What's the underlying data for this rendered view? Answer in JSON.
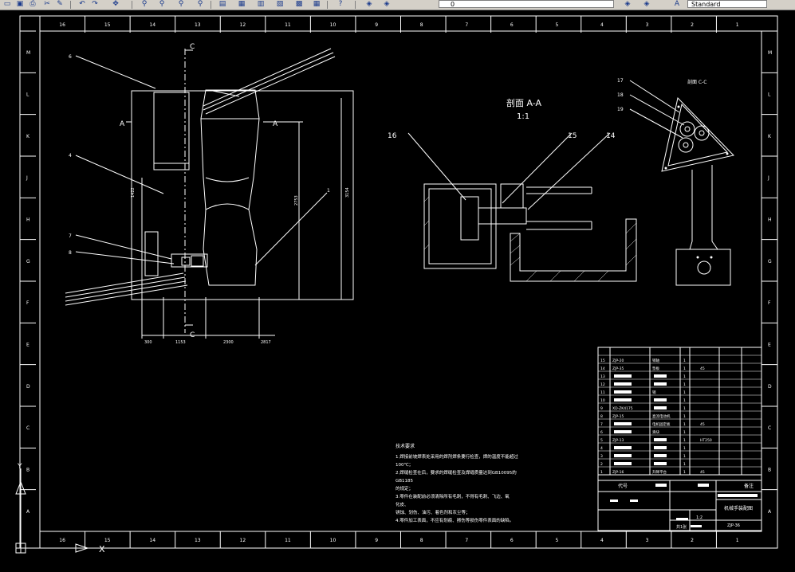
{
  "toolbar": {
    "style_value": "Standard",
    "layer_value": "0"
  },
  "border_columns": [
    "16",
    "15",
    "14",
    "13",
    "12",
    "11",
    "10",
    "9",
    "8",
    "7",
    "6",
    "5",
    "4",
    "3",
    "2",
    "1"
  ],
  "border_rows": [
    "M",
    "L",
    "K",
    "J",
    "H",
    "G",
    "F",
    "E",
    "D",
    "C",
    "B",
    "A"
  ],
  "drawing": {
    "section_aa_title": "剖面 A-A",
    "section_aa_scale": "1:1",
    "section_cc_title": "剖面 C-C",
    "section_marks": [
      "C",
      "C",
      "A",
      "A"
    ],
    "part_callouts_left": [
      "6",
      "4",
      "7",
      "8",
      "1"
    ],
    "part_callouts_mid": [
      "16",
      "15",
      "14"
    ],
    "part_callouts_right": [
      "17",
      "18",
      "19"
    ],
    "dimensions": [
      "300",
      "1153",
      "2300",
      "2817",
      "1422",
      "2753",
      "3154"
    ]
  },
  "notes": {
    "heading": "技术要求",
    "lines": [
      "1.焊接前坡焊表处采用的焊剂焊条要行检查，焊的温度不能超过",
      "100℃；",
      "2.焊缝检查在后，要求的焊缝检查及焊缝质量达到GB10095的",
      "GB1185",
      "的规定；",
      "3.零件在装配前必须清除所有毛刺，不得有毛刺、飞边、氧",
      "化皮、",
      "锈蚀、划伤、油污、着色剂和灰尘等；",
      "4.零件加工表面，不应有划痕、擦伤等损伤零件表面的缺陷。"
    ]
  },
  "title_block": {
    "bom_part_numbers": [
      "ZJP-20",
      "ZJP-35",
      "",
      "",
      "",
      "",
      "XD-ZK4175",
      "ZJP-15",
      "",
      "",
      "ZJP-13",
      "",
      "",
      "",
      "ZJP-16"
    ],
    "bom_names": [
      "销轴",
      "垫板",
      "",
      "",
      "销",
      "",
      "",
      "直流电动机",
      "电机固定板",
      "滑块",
      "",
      "",
      "",
      "",
      "升降平台"
    ],
    "bom_materials": [
      "",
      "45",
      "",
      "",
      "",
      "",
      "",
      "",
      "45",
      "",
      "HT250",
      "",
      "",
      "",
      "45"
    ],
    "header_label_code": "代号",
    "header_label_remark": "备注",
    "drawing_name": "机械手装配图",
    "drawing_number": "ZJP-36",
    "scale_label": "1:2",
    "sheet_label": "共1张"
  },
  "ucs": {
    "y_label": "Y",
    "x_label": "X"
  }
}
